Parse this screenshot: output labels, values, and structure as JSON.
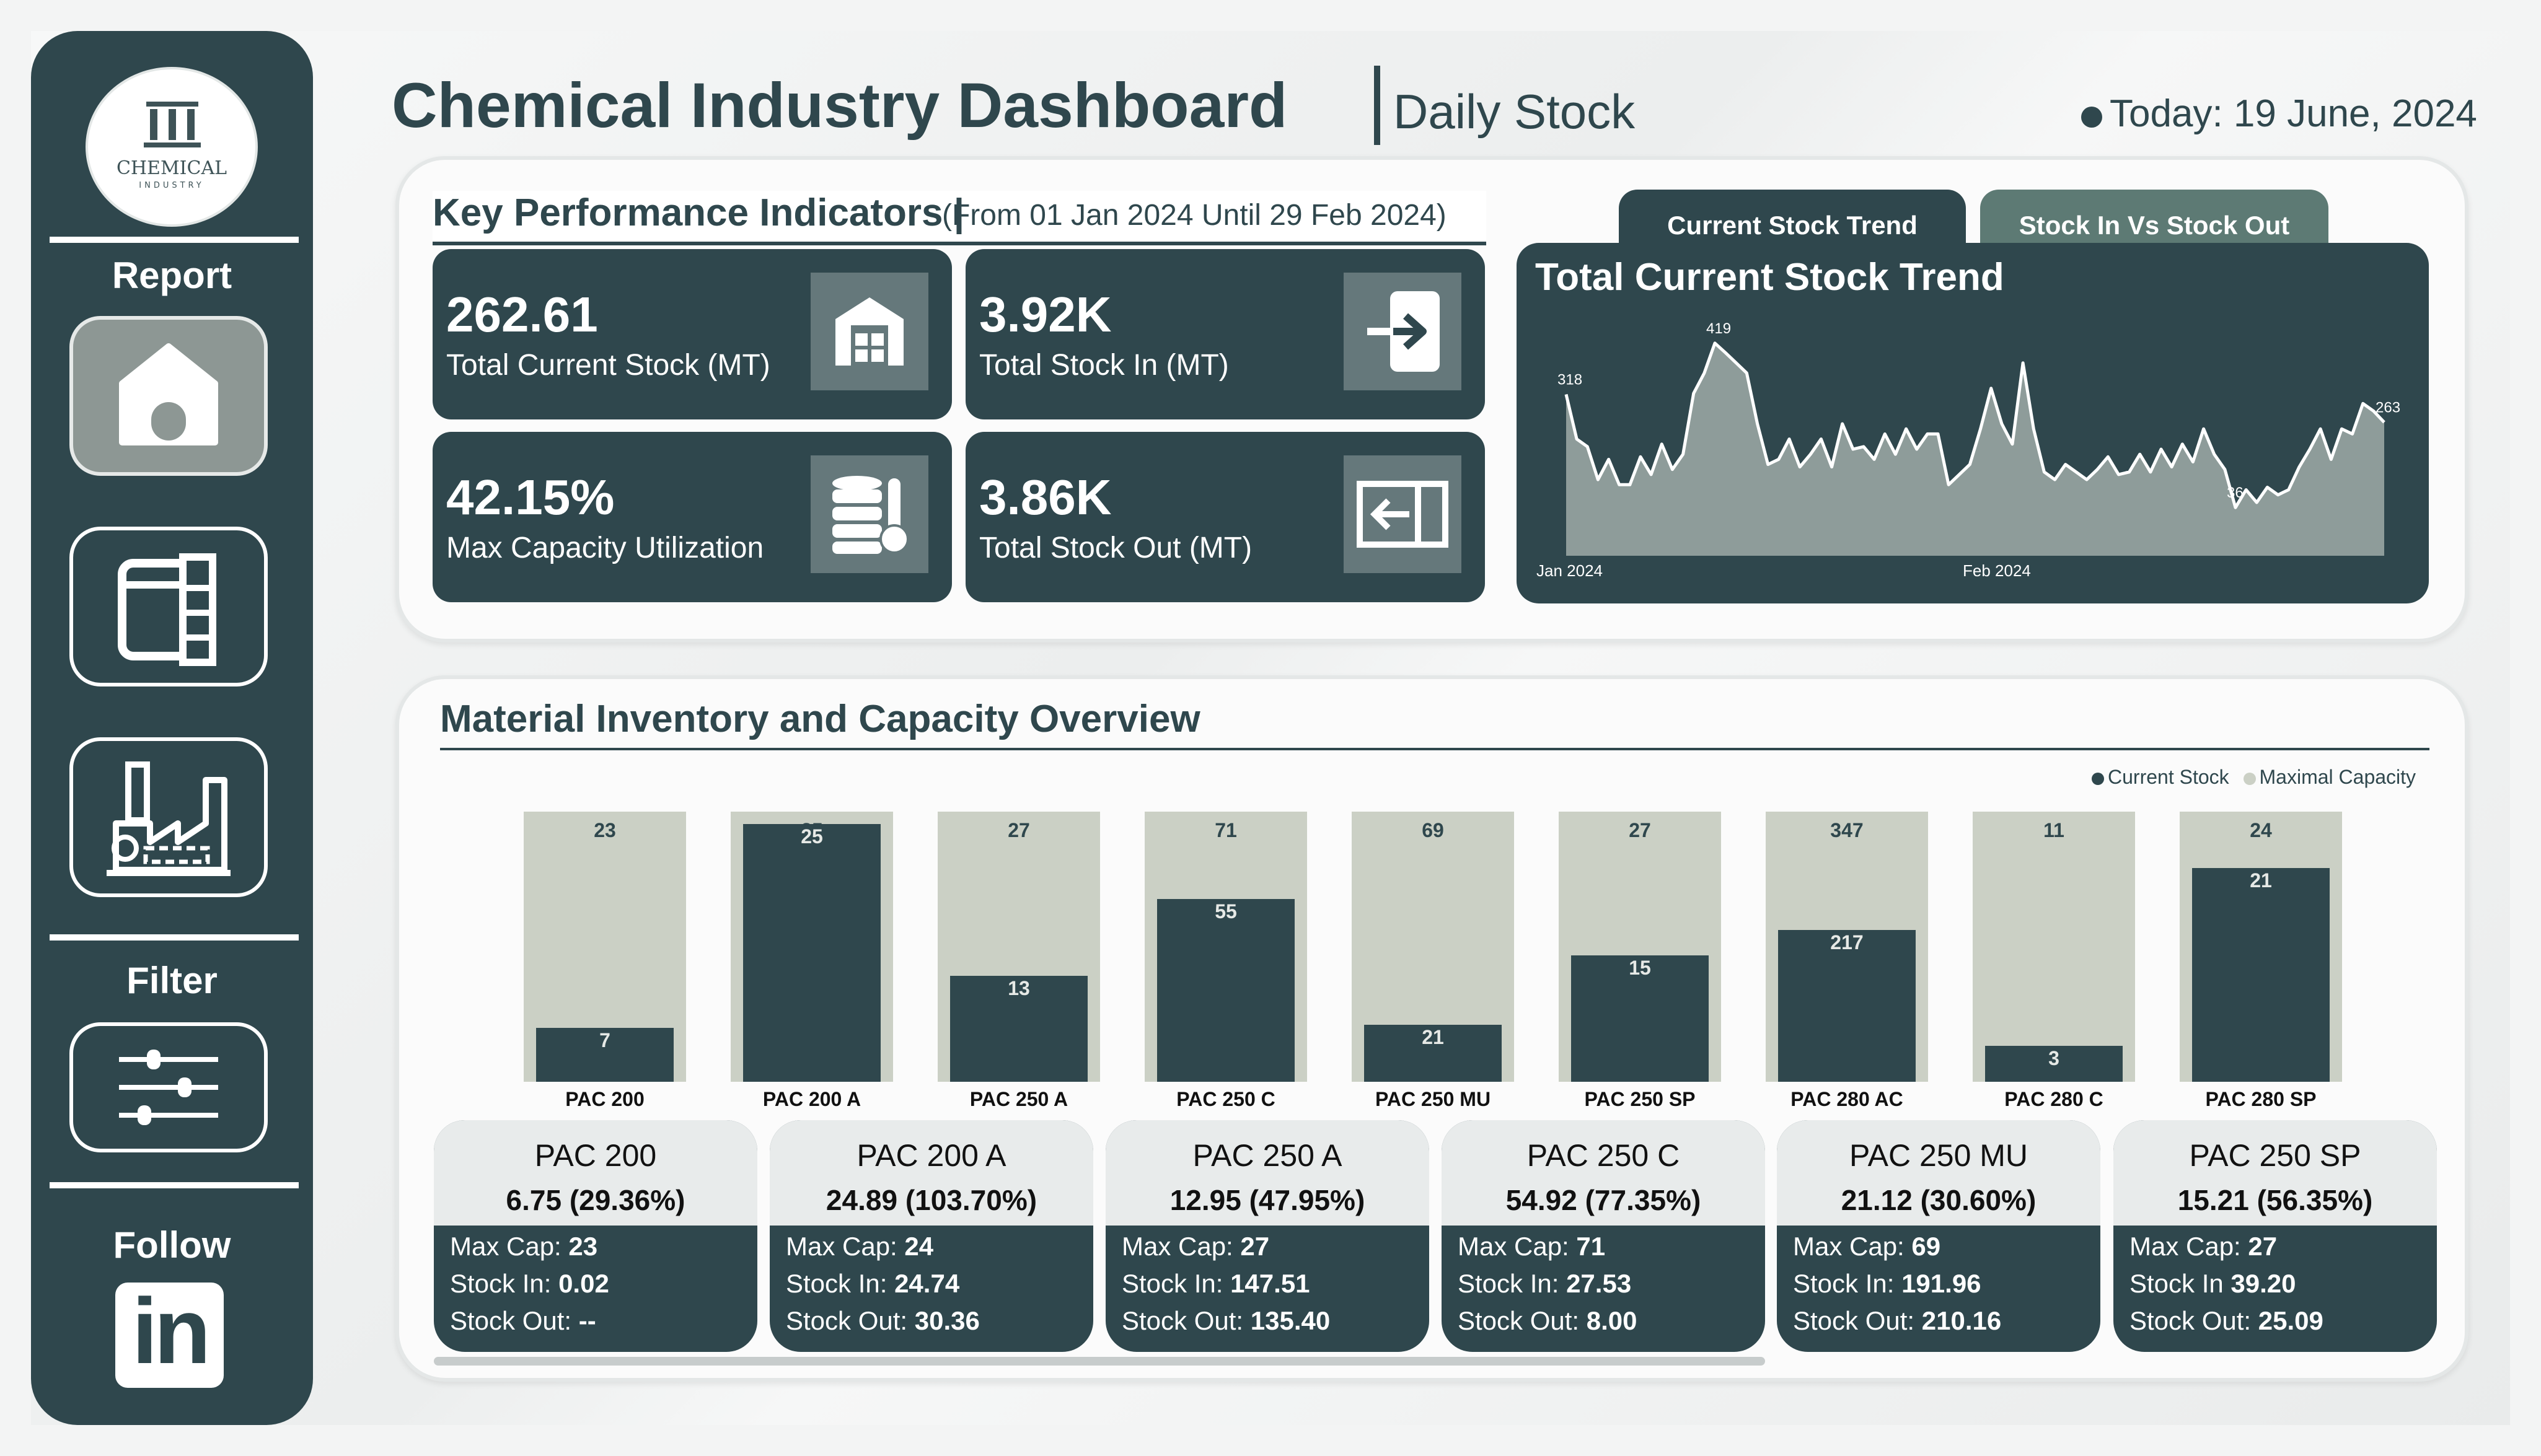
{
  "header": {
    "title": "Chemical Industry Dashboard",
    "subtitle": "Daily Stock",
    "today": "Today: 19 June, 2024"
  },
  "sidebar": {
    "logo_text": "CHEMICAL",
    "logo_subtext": "INDUSTRY",
    "report_label": "Report",
    "filter_label": "Filter",
    "follow_label": "Follow",
    "nav_items": [
      {
        "icon": "home-icon"
      },
      {
        "icon": "storage-tank-icon"
      },
      {
        "icon": "factory-icon"
      }
    ],
    "filter_icon": "sliders-icon",
    "linkedin_text": "in"
  },
  "kpi": {
    "heading": "Key Performance Indicators |",
    "range": "(From 01 Jan 2024 Until 29 Feb 2024)",
    "cards": [
      {
        "value": "262.61",
        "label": "Total Current Stock (MT)",
        "icon": "warehouse-icon"
      },
      {
        "value": "3.92K",
        "label": "Total Stock In (MT)",
        "icon": "arrow-in-icon"
      },
      {
        "value": "42.15%",
        "label": "Max Capacity Utilization",
        "icon": "database-thermometer-icon"
      },
      {
        "value": "3.86K",
        "label": "Total Stock Out (MT)",
        "icon": "arrow-out-icon"
      }
    ]
  },
  "trend": {
    "tabs": [
      "Current Stock Trend",
      "Stock In Vs Stock Out"
    ],
    "title": "Total Current Stock Trend",
    "x_labels": [
      "Jan 2024",
      "Feb 2024"
    ],
    "peak_labels": [
      "318",
      "419",
      "263",
      "36"
    ]
  },
  "inventory": {
    "title": "Material Inventory and Capacity Overview",
    "legend": [
      "Current Stock",
      "Maximal Capacity"
    ],
    "colors": {
      "current": "#2f474d",
      "capacity": "#cbd0c5"
    },
    "bars": [
      {
        "name": "PAC 200",
        "capacity": "23",
        "current": "7",
        "fill": 0.21
      },
      {
        "name": "PAC 200 A",
        "capacity": "25",
        "current": "25",
        "fill": 1.0
      },
      {
        "name": "PAC 250 A",
        "capacity": "27",
        "current": "13",
        "fill": 0.41
      },
      {
        "name": "PAC 250 C",
        "capacity": "71",
        "current": "55",
        "fill": 0.71
      },
      {
        "name": "PAC 250 MU",
        "capacity": "69",
        "current": "21",
        "fill": 0.22
      },
      {
        "name": "PAC 250 SP",
        "capacity": "27",
        "current": "15",
        "fill": 0.49
      },
      {
        "name": "PAC 280 AC",
        "capacity": "347",
        "current": "217",
        "fill": 0.59
      },
      {
        "name": "PAC 280 C",
        "capacity": "11",
        "current": "3",
        "fill": 0.14
      },
      {
        "name": "PAC 280 SP",
        "capacity": "24",
        "current": "21",
        "fill": 0.83
      }
    ],
    "cards": [
      {
        "name": "PAC 200",
        "value": "6.75 (29.36%)",
        "max_label": "Max Cap: ",
        "max": "23",
        "in_label": "Stock In: ",
        "in": "0.02",
        "out_label": "Stock Out: ",
        "out": "--"
      },
      {
        "name": "PAC 200 A",
        "value": "24.89 (103.70%)",
        "max_label": "Max Cap: ",
        "max": "24",
        "in_label": "Stock In: ",
        "in": "24.74",
        "out_label": "Stock Out: ",
        "out": "30.36"
      },
      {
        "name": "PAC 250 A",
        "value": "12.95 (47.95%)",
        "max_label": "Max Cap: ",
        "max": "27",
        "in_label": "Stock In: ",
        "in": "147.51",
        "out_label": "Stock Out: ",
        "out": "135.40"
      },
      {
        "name": "PAC 250 C",
        "value": "54.92 (77.35%)",
        "max_label": "Max Cap: ",
        "max": "71",
        "in_label": "Stock In: ",
        "in": "27.53",
        "out_label": "Stock Out: ",
        "out": "8.00"
      },
      {
        "name": "PAC 250 MU",
        "value": "21.12 (30.60%)",
        "max_label": "Max Cap: ",
        "max": "69",
        "in_label": "Stock In: ",
        "in": "191.96",
        "out_label": "Stock Out: ",
        "out": "210.16"
      },
      {
        "name": "PAC 250 SP",
        "value": "15.21 (56.35%)",
        "max_label": "Max Cap: ",
        "max": "27",
        "in_label": "Stock In ",
        "in": "39.20",
        "out_label": "Stock Out: ",
        "out": "25.09"
      }
    ]
  },
  "chart_data": {
    "type": "area",
    "title": "Total Current Stock Trend",
    "x_labels": [
      "Jan 2024",
      "Feb 2024"
    ],
    "values": [
      318,
      230,
      215,
      150,
      190,
      140,
      140,
      195,
      160,
      220,
      170,
      200,
      320,
      360,
      419,
      400,
      380,
      360,
      260,
      180,
      190,
      230,
      175,
      200,
      230,
      175,
      260,
      210,
      215,
      190,
      240,
      200,
      250,
      210,
      240,
      240,
      140,
      160,
      180,
      250,
      330,
      260,
      220,
      380,
      250,
      165,
      150,
      180,
      165,
      150,
      170,
      195,
      160,
      165,
      200,
      165,
      210,
      175,
      220,
      185,
      250,
      200,
      170,
      95,
      130,
      105,
      135,
      120,
      130,
      175,
      210,
      250,
      190,
      250,
      240,
      300,
      285,
      263
    ],
    "annotations": [
      {
        "index": 0,
        "label": "318"
      },
      {
        "index": 14,
        "label": "419"
      },
      {
        "index": 63,
        "label": "36"
      },
      {
        "index": 77,
        "label": "263"
      }
    ]
  }
}
